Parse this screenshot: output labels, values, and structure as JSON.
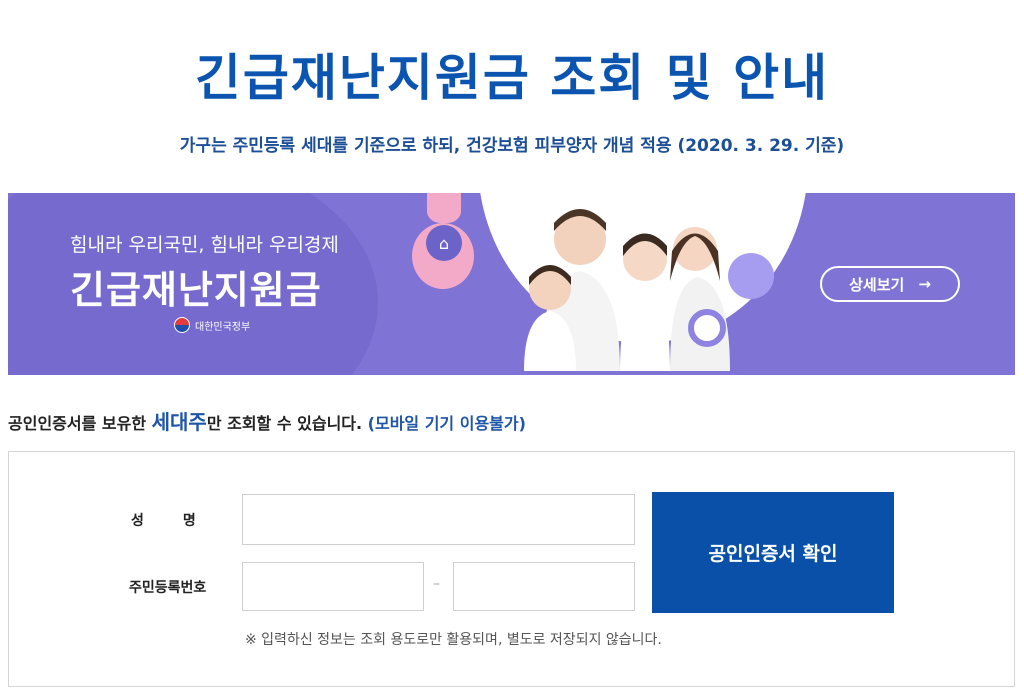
{
  "header": {
    "title": "긴급재난지원금 조회 및 안내",
    "subtitle": "가구는 주민등록 세대를 기준으로 하되, 건강보험 피부양자 개념 적용 (2020. 3. 29. 기준)"
  },
  "banner": {
    "slogan": "힘내라 우리국민, 힘내라 우리경제",
    "title": "긴급재난지원금",
    "gov_label": "대한민국정부",
    "detail_button": "상세보기",
    "detail_arrow": "→",
    "house_icon": "house-icon"
  },
  "notice": {
    "prefix": "공인인증서를 보유한 ",
    "highlight": "세대주",
    "middle": "만 조회할 수 있습니다. ",
    "mobile": "(모바일 기기 이용불가)"
  },
  "form": {
    "name_label": "성        명",
    "name_value": "",
    "rrn_label": "주민등록번호",
    "rrn_first": "",
    "rrn_dash": "–",
    "rrn_second": "",
    "cert_button": "공인인증서 확인",
    "privacy_note": "※ 입력하신 정보는 조회 용도로만 활용되며, 별도로 저장되지 않습니다."
  },
  "colors": {
    "title_blue": "#0b55b0",
    "banner_purple": "#7f73d6",
    "button_blue": "#0a50a8"
  }
}
